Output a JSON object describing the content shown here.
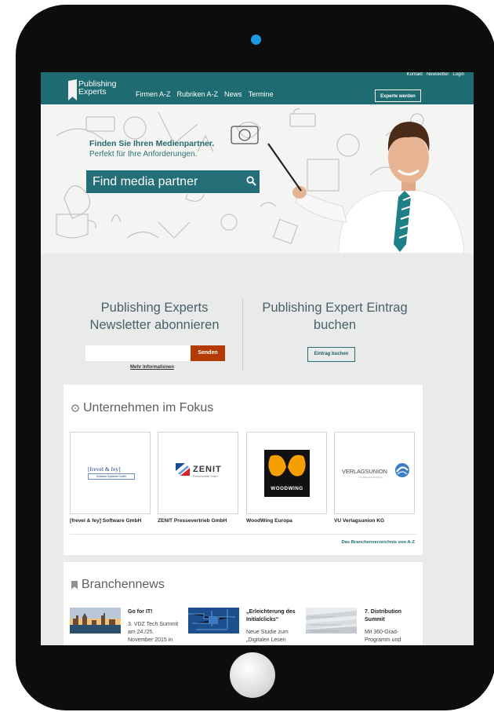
{
  "header": {
    "logo_line1": "Publishing",
    "logo_line2": "Experts",
    "nav": [
      "Firmen A-Z",
      "Rubriken A-Z",
      "News",
      "Termine"
    ],
    "top_links": [
      "Kontakt",
      "Newsletter",
      "Login"
    ],
    "cta_label": "Experte werden"
  },
  "hero": {
    "headline": "Finden Sie Ihren Medienpartner.",
    "subline": "Perfekt für Ihre Anforderungen.",
    "search_placeholder": "Find media partner"
  },
  "newsletter": {
    "title_line1": "Publishing Experts",
    "title_line2": "Newsletter abonnieren",
    "send_label": "Senden",
    "more_label": "Mehr Informationen"
  },
  "entry": {
    "title_line1": "Publishing Expert Eintrag",
    "title_line2": "buchen",
    "button_label": "Eintrag buchen"
  },
  "focus": {
    "title": "Unternehmen im Fokus",
    "companies": [
      {
        "name": "[frevel & fey] Software GmbH",
        "logo_text": "[frevel & fey]",
        "logo_sub": "Software Systeme GmbH"
      },
      {
        "name": "ZENIT Pressevertrieb GmbH",
        "logo_text": "ZENIT",
        "logo_sub": "Pressevertrieb GmbH"
      },
      {
        "name": "WoodWing Europa",
        "logo_text": "WOODWING",
        "logo_sub": ""
      },
      {
        "name": "VU Verlagsunion KG",
        "logo_text": "VERLAGSUNION",
        "logo_sub": "VU VERLAGSUNION KG"
      }
    ],
    "directory_link": "Das Branchenverzeichnis von A-Z"
  },
  "news": {
    "title": "Branchennews",
    "items": [
      {
        "headline": "Go for IT!",
        "text_lines": [
          "3. VDZ Tech Summit",
          "am 24./25.",
          "November 2015 in"
        ]
      },
      {
        "headline_lines": [
          "„Erleichterung des",
          "Initialclicks“"
        ],
        "text_lines": [
          "Neue Studie zum",
          "„Digitalen Lesen"
        ]
      },
      {
        "headline_lines": [
          "7. Distribution",
          "Summit"
        ],
        "text_lines": [
          "Mit 360-Grad-",
          "Programm und"
        ]
      }
    ]
  },
  "colors": {
    "brand": "#1f6b72",
    "accent": "#b33a00",
    "device": "#0d0d0d",
    "camera": "#1a9ae0"
  }
}
